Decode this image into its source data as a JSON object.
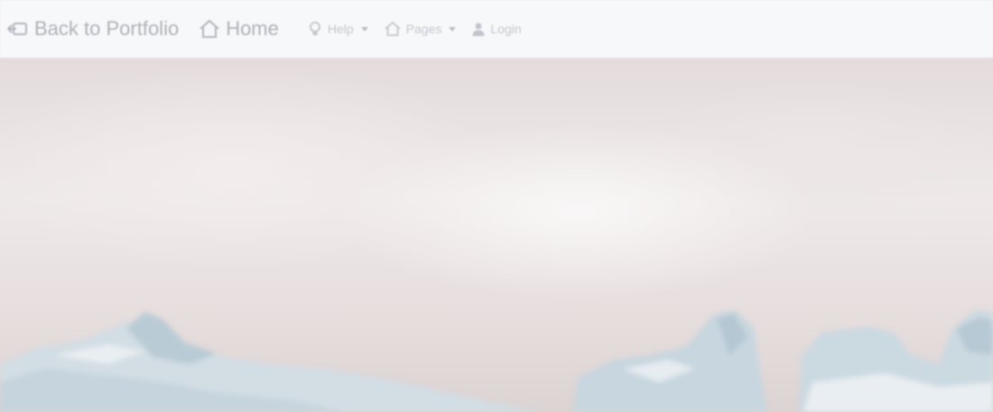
{
  "navbar": {
    "items": [
      {
        "label": "Back to Portfolio",
        "icon": "back-arrow-icon"
      },
      {
        "label": "Home",
        "icon": "home-icon"
      },
      {
        "label": "Help",
        "icon": "lightbulb-icon",
        "dropdown": true
      },
      {
        "label": "Pages",
        "icon": "home-icon",
        "dropdown": true
      },
      {
        "label": "Login",
        "icon": "user-icon"
      }
    ]
  },
  "hero": {
    "image": "glacier-ice-landscape"
  },
  "colors": {
    "navbar_bg": "#f7f8fa",
    "nav_text": "#b3b7be",
    "sky": "#ebe5e5",
    "ice": "#c9d7df"
  }
}
